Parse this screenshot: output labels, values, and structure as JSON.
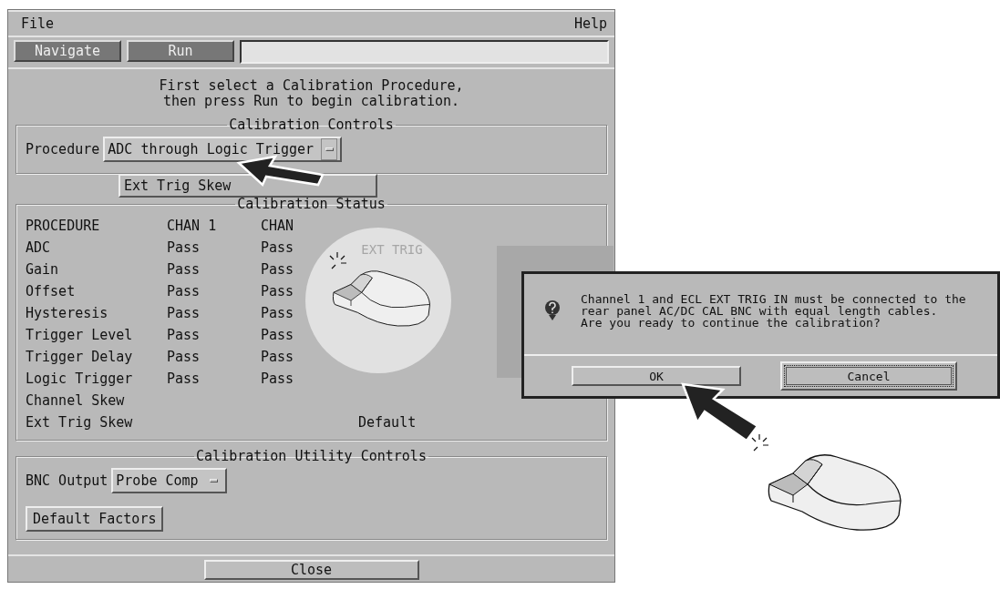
{
  "menu_bar": {
    "items": [
      "File",
      "Help"
    ]
  },
  "toolbar": {
    "buttons": [
      "Navigate",
      "Run"
    ]
  },
  "instructions": [
    "First select a Calibration Procedure,",
    "then press Run to begin calibration."
  ],
  "calibration_controls": {
    "title": "Calibration Controls",
    "procedure_label": "Procedure",
    "procedure_value": "ADC through Logic Trigger",
    "open_options": [
      "Ext Trig Skew"
    ]
  },
  "calibration_status": {
    "title": "Calibration Status",
    "columns": [
      "PROCEDURE",
      "CHAN 1",
      "CHAN"
    ],
    "rows": [
      {
        "procedure": "ADC",
        "chan_1": "Pass",
        "chan_2": "Pass"
      },
      {
        "procedure": "Gain",
        "chan_1": "Pass",
        "chan_2": "Pass"
      },
      {
        "procedure": "Offset",
        "chan_1": "Pass",
        "chan_2": "Pass"
      },
      {
        "procedure": "Hysteresis",
        "chan_1": "Pass",
        "chan_2": "Pass"
      },
      {
        "procedure": "Trigger Level",
        "chan_1": "Pass",
        "chan_2": "Pass"
      },
      {
        "procedure": "Trigger Delay",
        "chan_1": "Pass",
        "chan_2": "Pass"
      },
      {
        "procedure": "Logic Trigger",
        "chan_1": "Pass",
        "chan_2": "Pass"
      },
      {
        "procedure": "Channel Skew"
      },
      {
        "procedure": "Ext Trig Skew",
        "column_4": "Default"
      }
    ]
  },
  "utility_controls": {
    "title": "Calibration Utility Controls",
    "bnc_label": "BNC Output",
    "bnc_value": "Probe Comp",
    "button": "Default Factors"
  },
  "close_button": "Close",
  "magnifier": {
    "label": "EXT TRIG"
  },
  "dialog": {
    "message": [
      "Channel 1 and ECL EXT TRIG IN must be connected to the",
      "rear panel AC/DC CAL BNC with equal length cables.",
      "Are you ready to continue the calibration?"
    ],
    "buttons": [
      {
        "label": "OK",
        "focused": false
      },
      {
        "label": "Cancel",
        "focused": true
      }
    ]
  }
}
